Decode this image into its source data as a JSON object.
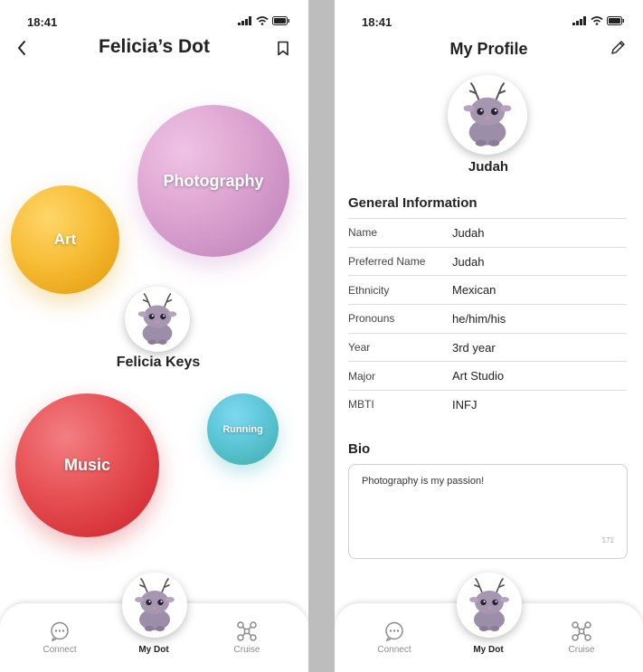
{
  "status": {
    "time": "18:41"
  },
  "dot_screen": {
    "title": "Felicia’s Dot",
    "back_icon": "chevron-left-icon",
    "bookmark_icon": "bookmark-icon",
    "center_name": "Felicia Keys",
    "bubbles": [
      {
        "label": "Photography",
        "color": "#d9a0cf"
      },
      {
        "label": "Art",
        "color": "#f1b523"
      },
      {
        "label": "Music",
        "color": "#e2454c"
      },
      {
        "label": "Running",
        "color": "#5cc6d8"
      }
    ]
  },
  "profile_screen": {
    "title": "My Profile",
    "edit_icon": "pencil-icon",
    "name": "Judah",
    "general_info_title": "General Information",
    "info": [
      {
        "key": "Name",
        "value": "Judah"
      },
      {
        "key": "Preferred Name",
        "value": "Judah"
      },
      {
        "key": "Ethnicity",
        "value": "Mexican"
      },
      {
        "key": "Pronouns",
        "value": "he/him/his"
      },
      {
        "key": "Year",
        "value": "3rd year"
      },
      {
        "key": "Major",
        "value": "Art Studio"
      },
      {
        "key": "MBTI",
        "value": "INFJ"
      }
    ],
    "bio_title": "Bio",
    "bio_text": "Photography is my passion!",
    "bio_count": "171"
  },
  "tabbar": {
    "connect": "Connect",
    "mydot": "My Dot",
    "cruise": "Cruise"
  }
}
